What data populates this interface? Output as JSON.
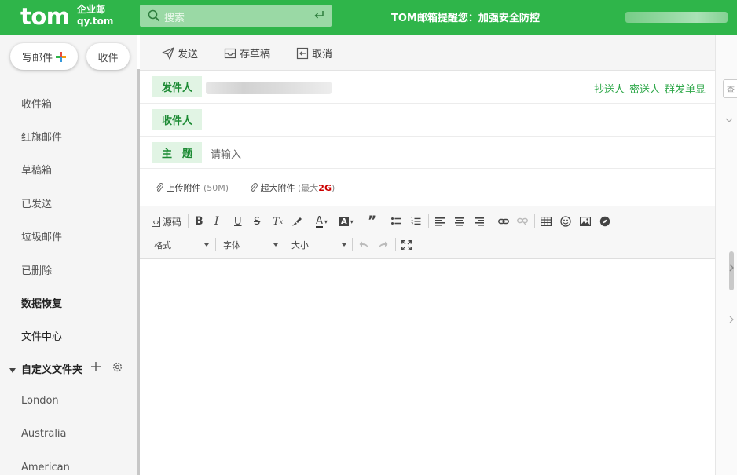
{
  "header": {
    "logo_main": "tom",
    "logo_sub_1": "企业邮",
    "logo_sub_2": "qy.tom",
    "search_placeholder": "搜索",
    "notice": "TOM邮箱提醒您：加强安全防控"
  },
  "sidebar": {
    "compose_label": "写邮件",
    "receive_label": "收件",
    "folders": [
      {
        "label": "收件箱"
      },
      {
        "label": "红旗邮件"
      },
      {
        "label": "草稿箱"
      },
      {
        "label": "已发送"
      },
      {
        "label": "垃圾邮件"
      },
      {
        "label": "已删除"
      },
      {
        "label": "数据恢复"
      },
      {
        "label": "文件中心"
      }
    ],
    "custom_folders_title": "自定义文件夹",
    "custom_folders": [
      {
        "label": "London"
      },
      {
        "label": "Australia"
      },
      {
        "label": "American"
      }
    ]
  },
  "toolbar": {
    "send_label": "发送",
    "draft_label": "存草稿",
    "cancel_label": "取消"
  },
  "compose": {
    "from_label": "发件人",
    "to_label": "收件人",
    "subject_label": "主　题",
    "subject_placeholder": "请输入",
    "cc_label": "抄送人",
    "bcc_label": "密送人",
    "group_label": "群发单显",
    "attach_label": "上传附件",
    "attach_limit": "(50M)",
    "big_attach_label": "超大附件",
    "big_attach_limit_prefix": "(最大",
    "big_attach_limit_value": "2G",
    "big_attach_limit_suffix": ")"
  },
  "editor": {
    "source_label": "源码",
    "format_label": "格式",
    "font_label": "字体",
    "size_label": "大小"
  },
  "right_panel": {
    "box_text": "查"
  },
  "colors": {
    "brand_green": "#2fb54a",
    "label_bg": "#e1f4e4",
    "label_text": "#1b8a33",
    "accent_red": "#c00000"
  }
}
